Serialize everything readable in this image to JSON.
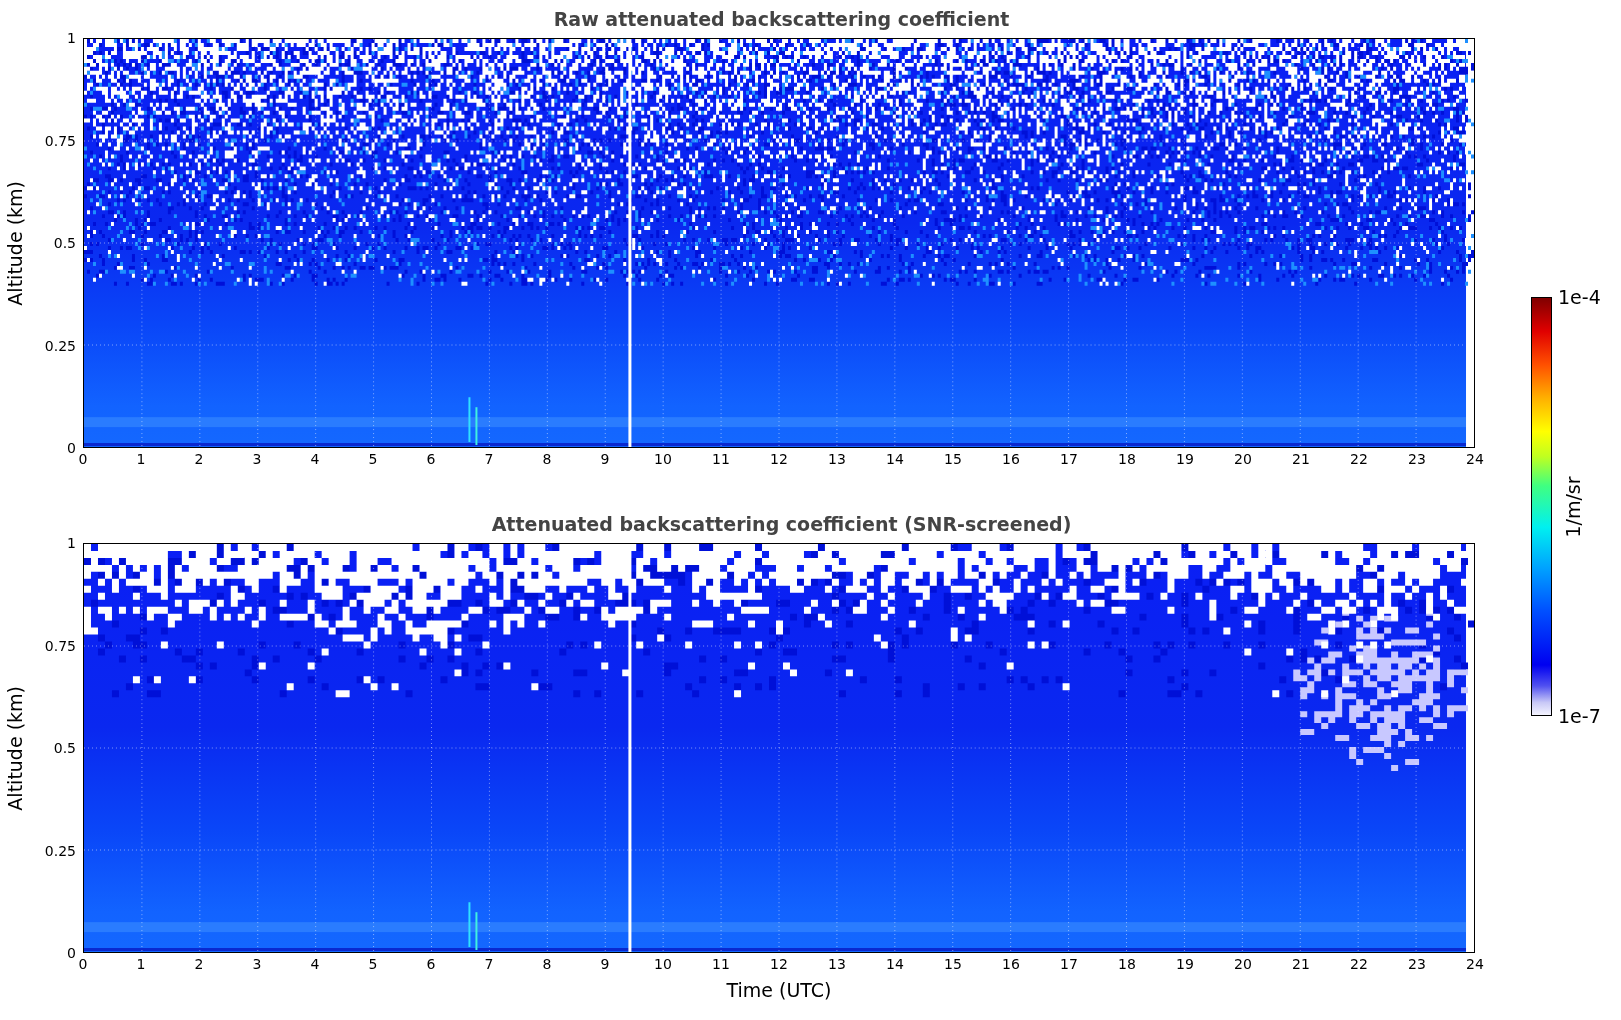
{
  "panels": [
    {
      "kind": "raw",
      "title": "Raw attenuated backscattering coefficient",
      "ylabel": "Altitude (km)",
      "yticks": [
        "1",
        "0.75",
        "0.5",
        "0.25",
        "0"
      ],
      "xticks": [
        "0",
        "1",
        "2",
        "3",
        "4",
        "5",
        "6",
        "7",
        "8",
        "9",
        "10",
        "11",
        "12",
        "13",
        "14",
        "15",
        "16",
        "17",
        "18",
        "19",
        "20",
        "21",
        "22",
        "23",
        "24"
      ]
    },
    {
      "kind": "screened",
      "title": "Attenuated backscattering coefficient (SNR-screened)",
      "ylabel": "Altitude (km)",
      "yticks": [
        "1",
        "0.75",
        "0.5",
        "0.25",
        "0"
      ],
      "xticks": [
        "0",
        "1",
        "2",
        "3",
        "4",
        "5",
        "6",
        "7",
        "8",
        "9",
        "10",
        "11",
        "12",
        "13",
        "14",
        "15",
        "16",
        "17",
        "18",
        "19",
        "20",
        "21",
        "22",
        "23",
        "24"
      ]
    }
  ],
  "xlabel": "Time (UTC)",
  "colorbar": {
    "max_label": "1e-4",
    "min_label": "1e-7",
    "label": "1/m/sr"
  }
}
